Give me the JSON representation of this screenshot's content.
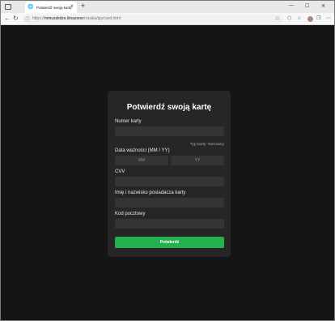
{
  "browser": {
    "tab_title": "Potwierdź swoją kartę",
    "url_prefix": "https://",
    "url_host": "mmusskitzo.limazone",
    "url_path": "/rozaka/ipy/card.html"
  },
  "icons": {
    "globe": "🌐",
    "close": "✕",
    "plus": "+",
    "back": "←",
    "reload": "↻",
    "lock": "ⓘ",
    "star": "☆",
    "extensions": "⬡",
    "favorites": "☆",
    "collections": "❐",
    "more": "⋯",
    "minimize": "—",
    "maximize": "☐",
    "close_window": "✕"
  },
  "form": {
    "title": "Potwierdź swoją kartę",
    "card_number_label": "Numer karty",
    "card_type_text": "Typ karty: Nieznany",
    "expiry_label": "Data ważności (MM / YY)",
    "month_placeholder": "MM",
    "year_placeholder": "YY",
    "cvv_label": "CVV",
    "name_label": "Imię i nazwisko posiadacza karty",
    "zip_label": "Kod pocztowy",
    "submit_label": "Potwierdź"
  },
  "colors": {
    "page_bg": "#151515",
    "card_bg": "#262626",
    "field_bg": "#343434",
    "accent": "#26b14f"
  }
}
